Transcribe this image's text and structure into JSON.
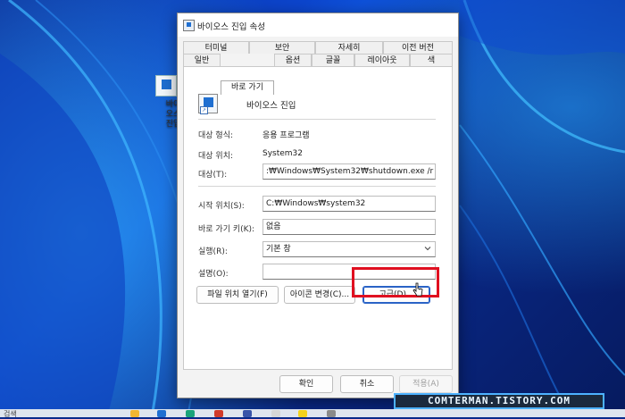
{
  "dialog": {
    "title": "바이오스 진입 속성",
    "tabs_row1": [
      "터미널",
      "보안",
      "자세히",
      "이전 버전"
    ],
    "tabs_row2": [
      "일반",
      "바로 가기",
      "옵션",
      "글꼴",
      "레이아웃",
      "색"
    ],
    "active_tab": "바로 가기",
    "shortcut_name": "바이오스 진입",
    "fields": {
      "target_type_label": "대상 형식:",
      "target_type_value": "응용 프로그램",
      "target_location_label": "대상 위치:",
      "target_location_value": "System32",
      "target_label": "대상(T):",
      "target_value": ":₩Windows₩System32₩shutdown.exe /r /fw /t 5",
      "start_in_label": "시작 위치(S):",
      "start_in_value": "C:₩Windows₩system32",
      "shortcut_key_label": "바로 가기 키(K):",
      "shortcut_key_value": "없음",
      "run_label": "실행(R):",
      "run_value": "기본 창",
      "comment_label": "설명(O):",
      "comment_value": ""
    },
    "buttons": {
      "open_location": "파일 위치 열기(F)",
      "change_icon": "아이콘 변경(C)...",
      "advanced": "고급(D)..."
    },
    "footer": {
      "ok": "확인",
      "cancel": "취소",
      "apply": "적용(A)"
    }
  },
  "desktop_icon": {
    "label_line1": "바이오스",
    "label_line2": "진입"
  },
  "taskbar": {
    "search_fragment": "검색"
  },
  "watermark": "COMTERMAN.TISTORY.COM",
  "colors": {
    "highlight": "#e01020",
    "accent": "#2a63c6"
  }
}
